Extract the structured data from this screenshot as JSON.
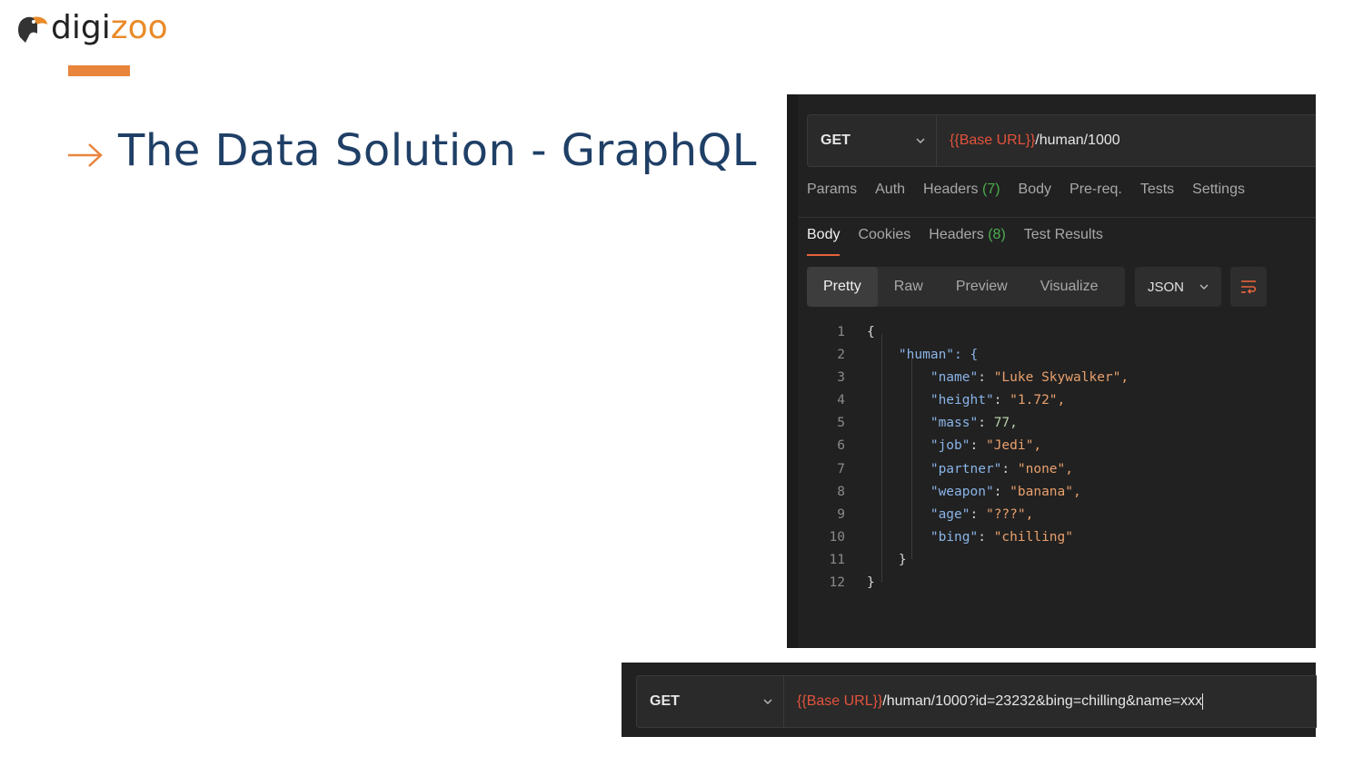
{
  "slide": {
    "logo_dark": "digi",
    "logo_orange": "zoo",
    "title": "The Data Solution - GraphQL"
  },
  "request": {
    "method": "GET",
    "url_var": "{{Base URL}}",
    "url_path": "/human/1000",
    "tabs": [
      {
        "label": "Params"
      },
      {
        "label": "Auth"
      },
      {
        "label": "Headers",
        "count": "(7)"
      },
      {
        "label": "Body"
      },
      {
        "label": "Pre-req."
      },
      {
        "label": "Tests"
      },
      {
        "label": "Settings"
      }
    ]
  },
  "response": {
    "tabs": [
      {
        "label": "Body",
        "active": true
      },
      {
        "label": "Cookies"
      },
      {
        "label": "Headers",
        "count": "(8)"
      },
      {
        "label": "Test Results"
      }
    ],
    "views": [
      "Pretty",
      "Raw",
      "Preview",
      "Visualize"
    ],
    "active_view": "Pretty",
    "format": "JSON",
    "lines": [
      {
        "n": "1",
        "text": "{"
      },
      {
        "n": "2",
        "text": "\"human\": {"
      },
      {
        "n": "3",
        "key": "\"name\"",
        "val": "\"Luke Skywalker\","
      },
      {
        "n": "4",
        "key": "\"height\"",
        "val": "\"1.72\","
      },
      {
        "n": "5",
        "key": "\"mass\"",
        "num": "77,"
      },
      {
        "n": "6",
        "key": "\"job\"",
        "val": "\"Jedi\","
      },
      {
        "n": "7",
        "key": "\"partner\"",
        "val": "\"none\","
      },
      {
        "n": "8",
        "key": "\"weapon\"",
        "val": "\"banana\","
      },
      {
        "n": "9",
        "key": "\"age\"",
        "val": "\"???\","
      },
      {
        "n": "10",
        "key": "\"bing\"",
        "val": "\"chilling\""
      },
      {
        "n": "11",
        "text": "}"
      },
      {
        "n": "12",
        "text": "}"
      }
    ]
  },
  "bottom_request": {
    "method": "GET",
    "url_var": "{{Base URL}}",
    "url_path": "/human/1000?id=23232&bing=chilling&name=xxx"
  },
  "colors": {
    "accent": "#e8843c",
    "title": "#1f3f66",
    "panel_bg": "#212121",
    "url_var": "#e2533c",
    "count_green": "#4cae4f"
  }
}
